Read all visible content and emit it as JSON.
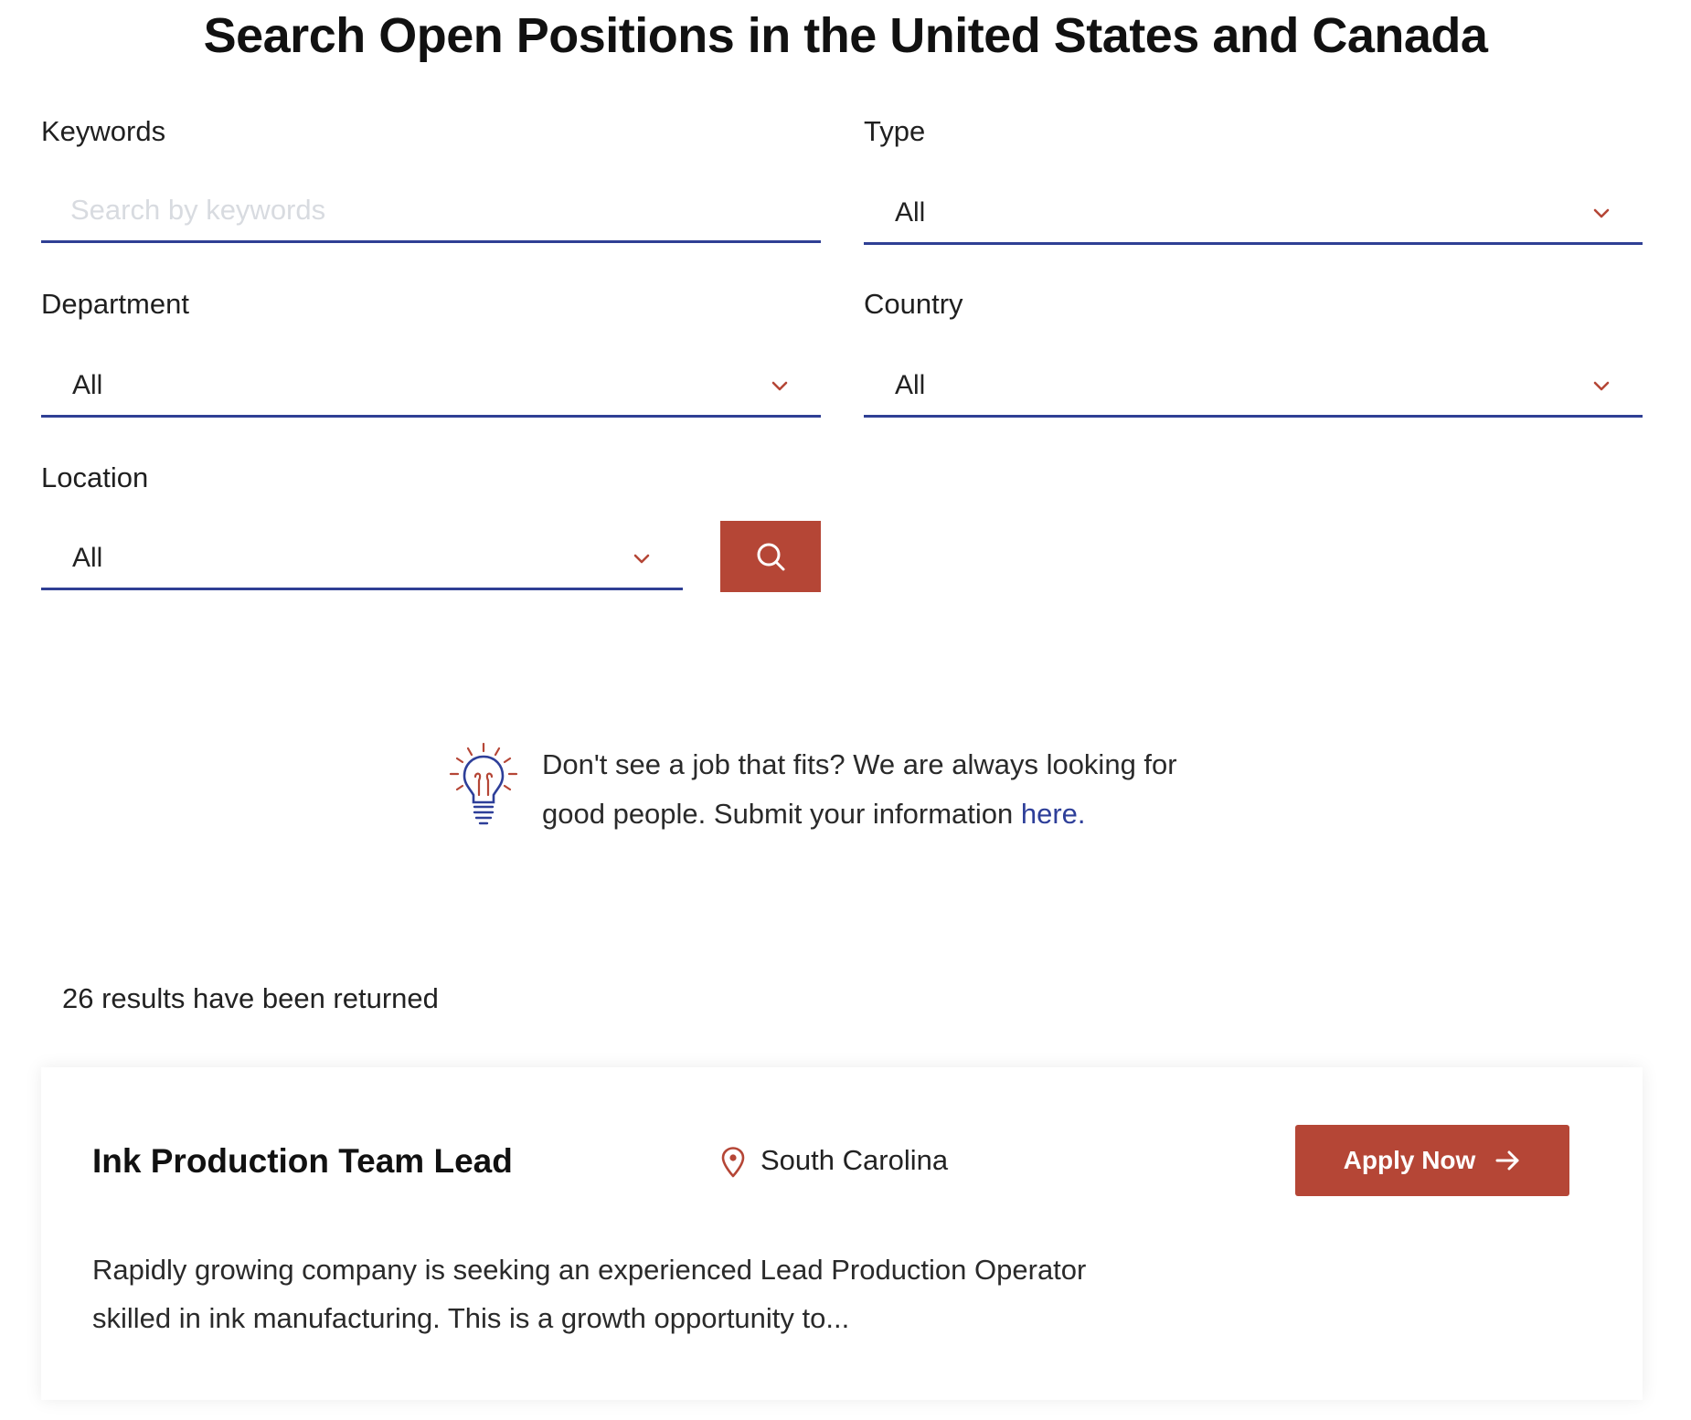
{
  "page": {
    "title": "Search Open Positions in the United States and Canada"
  },
  "filters": {
    "keywords": {
      "label": "Keywords",
      "placeholder": "Search by keywords",
      "value": ""
    },
    "type": {
      "label": "Type",
      "value": "All"
    },
    "department": {
      "label": "Department",
      "value": "All"
    },
    "country": {
      "label": "Country",
      "value": "All"
    },
    "location": {
      "label": "Location",
      "value": "All"
    }
  },
  "search_button": {
    "icon": "search-icon"
  },
  "tip": {
    "icon": "lightbulb-icon",
    "text": "Don't see a job that fits? We are always looking for good people. Submit your information ",
    "link_text": "here."
  },
  "results": {
    "count_text": "26 results have been returned",
    "jobs": [
      {
        "title": "Ink Production Team Lead",
        "location": "South Carolina",
        "apply_label": "Apply Now",
        "description": "Rapidly growing company is seeking an experienced Lead Production Operator skilled in ink manufacturing. This is a growth opportunity to..."
      }
    ]
  },
  "colors": {
    "accent": "#b54636",
    "underline": "#2f3f94",
    "link": "#2e3f99"
  }
}
